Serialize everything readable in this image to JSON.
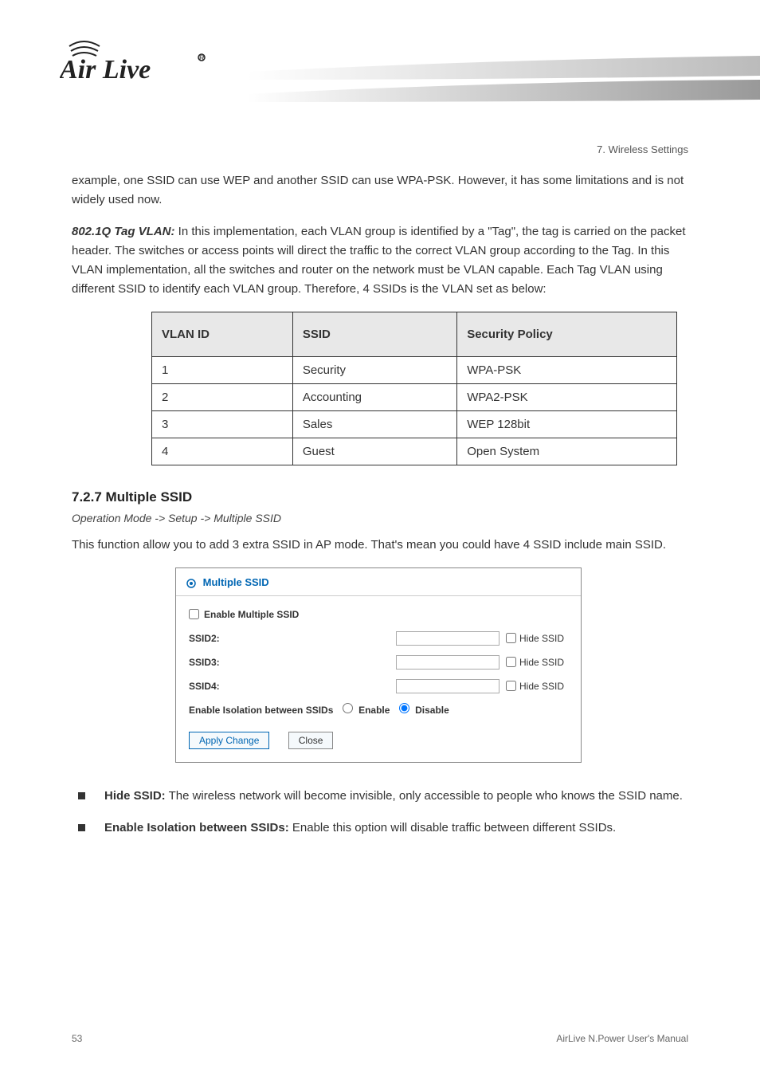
{
  "page_header": "7. Wireless Settings",
  "logo_text": "Air Live",
  "para1": "example, one SSID can use WEP and another SSID can use WPA-PSK. However, it has some limitations and is not widely used now.",
  "para2_prefix": "802.1Q Tag VLAN:",
  "para2": " In this implementation, each VLAN group is identified by a \"Tag\", the tag is carried on the packet header. The switches or access points will direct the traffic to the correct VLAN group according to the Tag. In this VLAN implementation, all the switches and router on the network must be VLAN capable. Each Tag VLAN using different SSID to identify each VLAN group. Therefore, 4 SSIDs is the VLAN set as below:",
  "table_headers": [
    "VLAN ID",
    "SSID",
    "Security Policy"
  ],
  "table_rows": [
    [
      "1",
      "Security",
      "WPA-PSK"
    ],
    [
      "2",
      "Accounting",
      "WPA2-PSK"
    ],
    [
      "3",
      "Sales",
      "WEP 128bit"
    ],
    [
      "4",
      "Guest",
      "Open System"
    ]
  ],
  "section_heading": "7.2.7 Multiple SSID",
  "subheading": "Operation Mode -> Setup -> Multiple SSID",
  "para3": "This function allow you to add 3 extra SSID in AP mode. That's mean you could have 4 SSID include main SSID.",
  "panel_title": "Multiple SSID",
  "panel_enable_label": "Enable Multiple SSID",
  "panel_ssids": [
    {
      "label": "SSID2:",
      "hide": "Hide SSID"
    },
    {
      "label": "SSID3:",
      "hide": "Hide SSID"
    },
    {
      "label": "SSID4:",
      "hide": "Hide SSID"
    }
  ],
  "isolation_label": "Enable Isolation between SSIDs",
  "isolation_enable": "Enable",
  "isolation_disable": "Disable",
  "apply_button": "Apply Change",
  "close_button": "Close",
  "bullet1_bold": "Hide SSID:",
  "bullet1_text": " The wireless network will become invisible, only accessible to people who knows the SSID name.",
  "bullet2_bold": "Enable Isolation between SSIDs:",
  "bullet2_text": " Enable this option will disable traffic between different SSIDs.",
  "footer_page": "53",
  "footer_text": "AirLive N.Power User's Manual"
}
